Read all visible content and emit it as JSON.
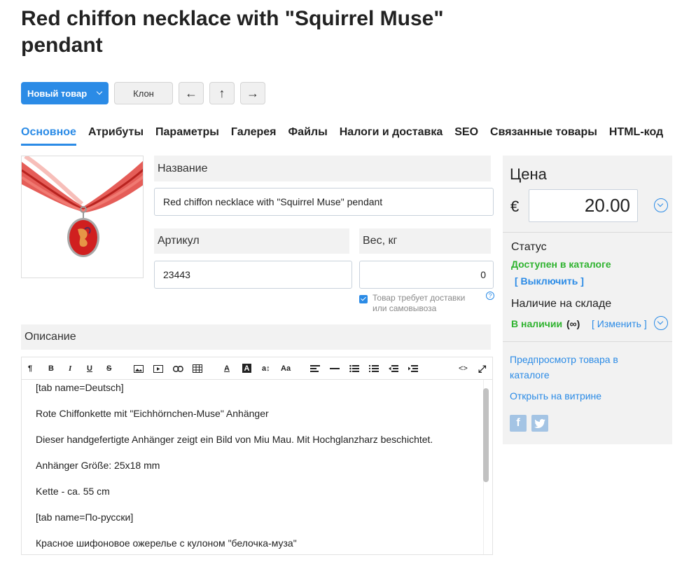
{
  "page": {
    "title": "Red chiffon necklace with \"Squirrel Muse\" pendant"
  },
  "toolbar": {
    "new_product": "Новый товар",
    "clone": "Клон",
    "prev_icon": "←",
    "up_icon": "↑",
    "next_icon": "→"
  },
  "tabs": [
    {
      "label": "Основное",
      "active": true
    },
    {
      "label": "Атрибуты"
    },
    {
      "label": "Параметры"
    },
    {
      "label": "Галерея"
    },
    {
      "label": "Файлы"
    },
    {
      "label": "Налоги и доставка"
    },
    {
      "label": "SEO"
    },
    {
      "label": "Связанные товары"
    },
    {
      "label": "HTML-код"
    }
  ],
  "form": {
    "name_label": "Название",
    "name_value": "Red chiffon necklace with \"Squirrel Muse\" pendant",
    "sku_label": "Артикул",
    "sku_value": "23443",
    "weight_label": "Вес, кг",
    "weight_value": "0",
    "delivery_checked": true,
    "delivery_text": "Товар требует доставки или самовывоза",
    "help_icon": "?",
    "description_label": "Описание"
  },
  "editor": {
    "toolbar": {
      "paragraph": "¶",
      "bold": "B",
      "italic": "I",
      "underline": "U",
      "strike": "S",
      "font_color": "A",
      "bg_color": "A",
      "font_size": "a↕",
      "font_family": "Aa",
      "code": "<>",
      "fullscreen": "⤢"
    },
    "lines": [
      "[tab name=Deutsch]",
      "Rote Chiffonkette mit \"Eichhörnchen-Muse\" Anhänger",
      "Dieser handgefertigte Anhänger zeigt ein Bild von Miu Mau. Mit Hochglanzharz beschichtet.",
      "Anhänger Größe: 25x18 mm",
      "Kette - ca. 55 cm",
      "[tab name=По-русски]",
      "Красное шифоновое ожерелье с кулоном \"белочка-муза\""
    ]
  },
  "sidebar": {
    "price_title": "Цена",
    "currency": "€",
    "price_value": "20.00",
    "status_label": "Статус",
    "status_value": "Доступен в каталоге",
    "disable_link": "[ Выключить ]",
    "stock_label": "Наличие на складе",
    "stock_value": "В наличии",
    "stock_qty": "(∞)",
    "change_link": "[ Изменить ]",
    "preview_link": "Предпросмотр товара в каталоге",
    "storefront_link": "Открыть на витрине",
    "facebook": "f",
    "twitter": "t"
  },
  "colors": {
    "accent": "#2b8be6",
    "success": "#2fb32f",
    "panel": "#f2f2f2"
  }
}
